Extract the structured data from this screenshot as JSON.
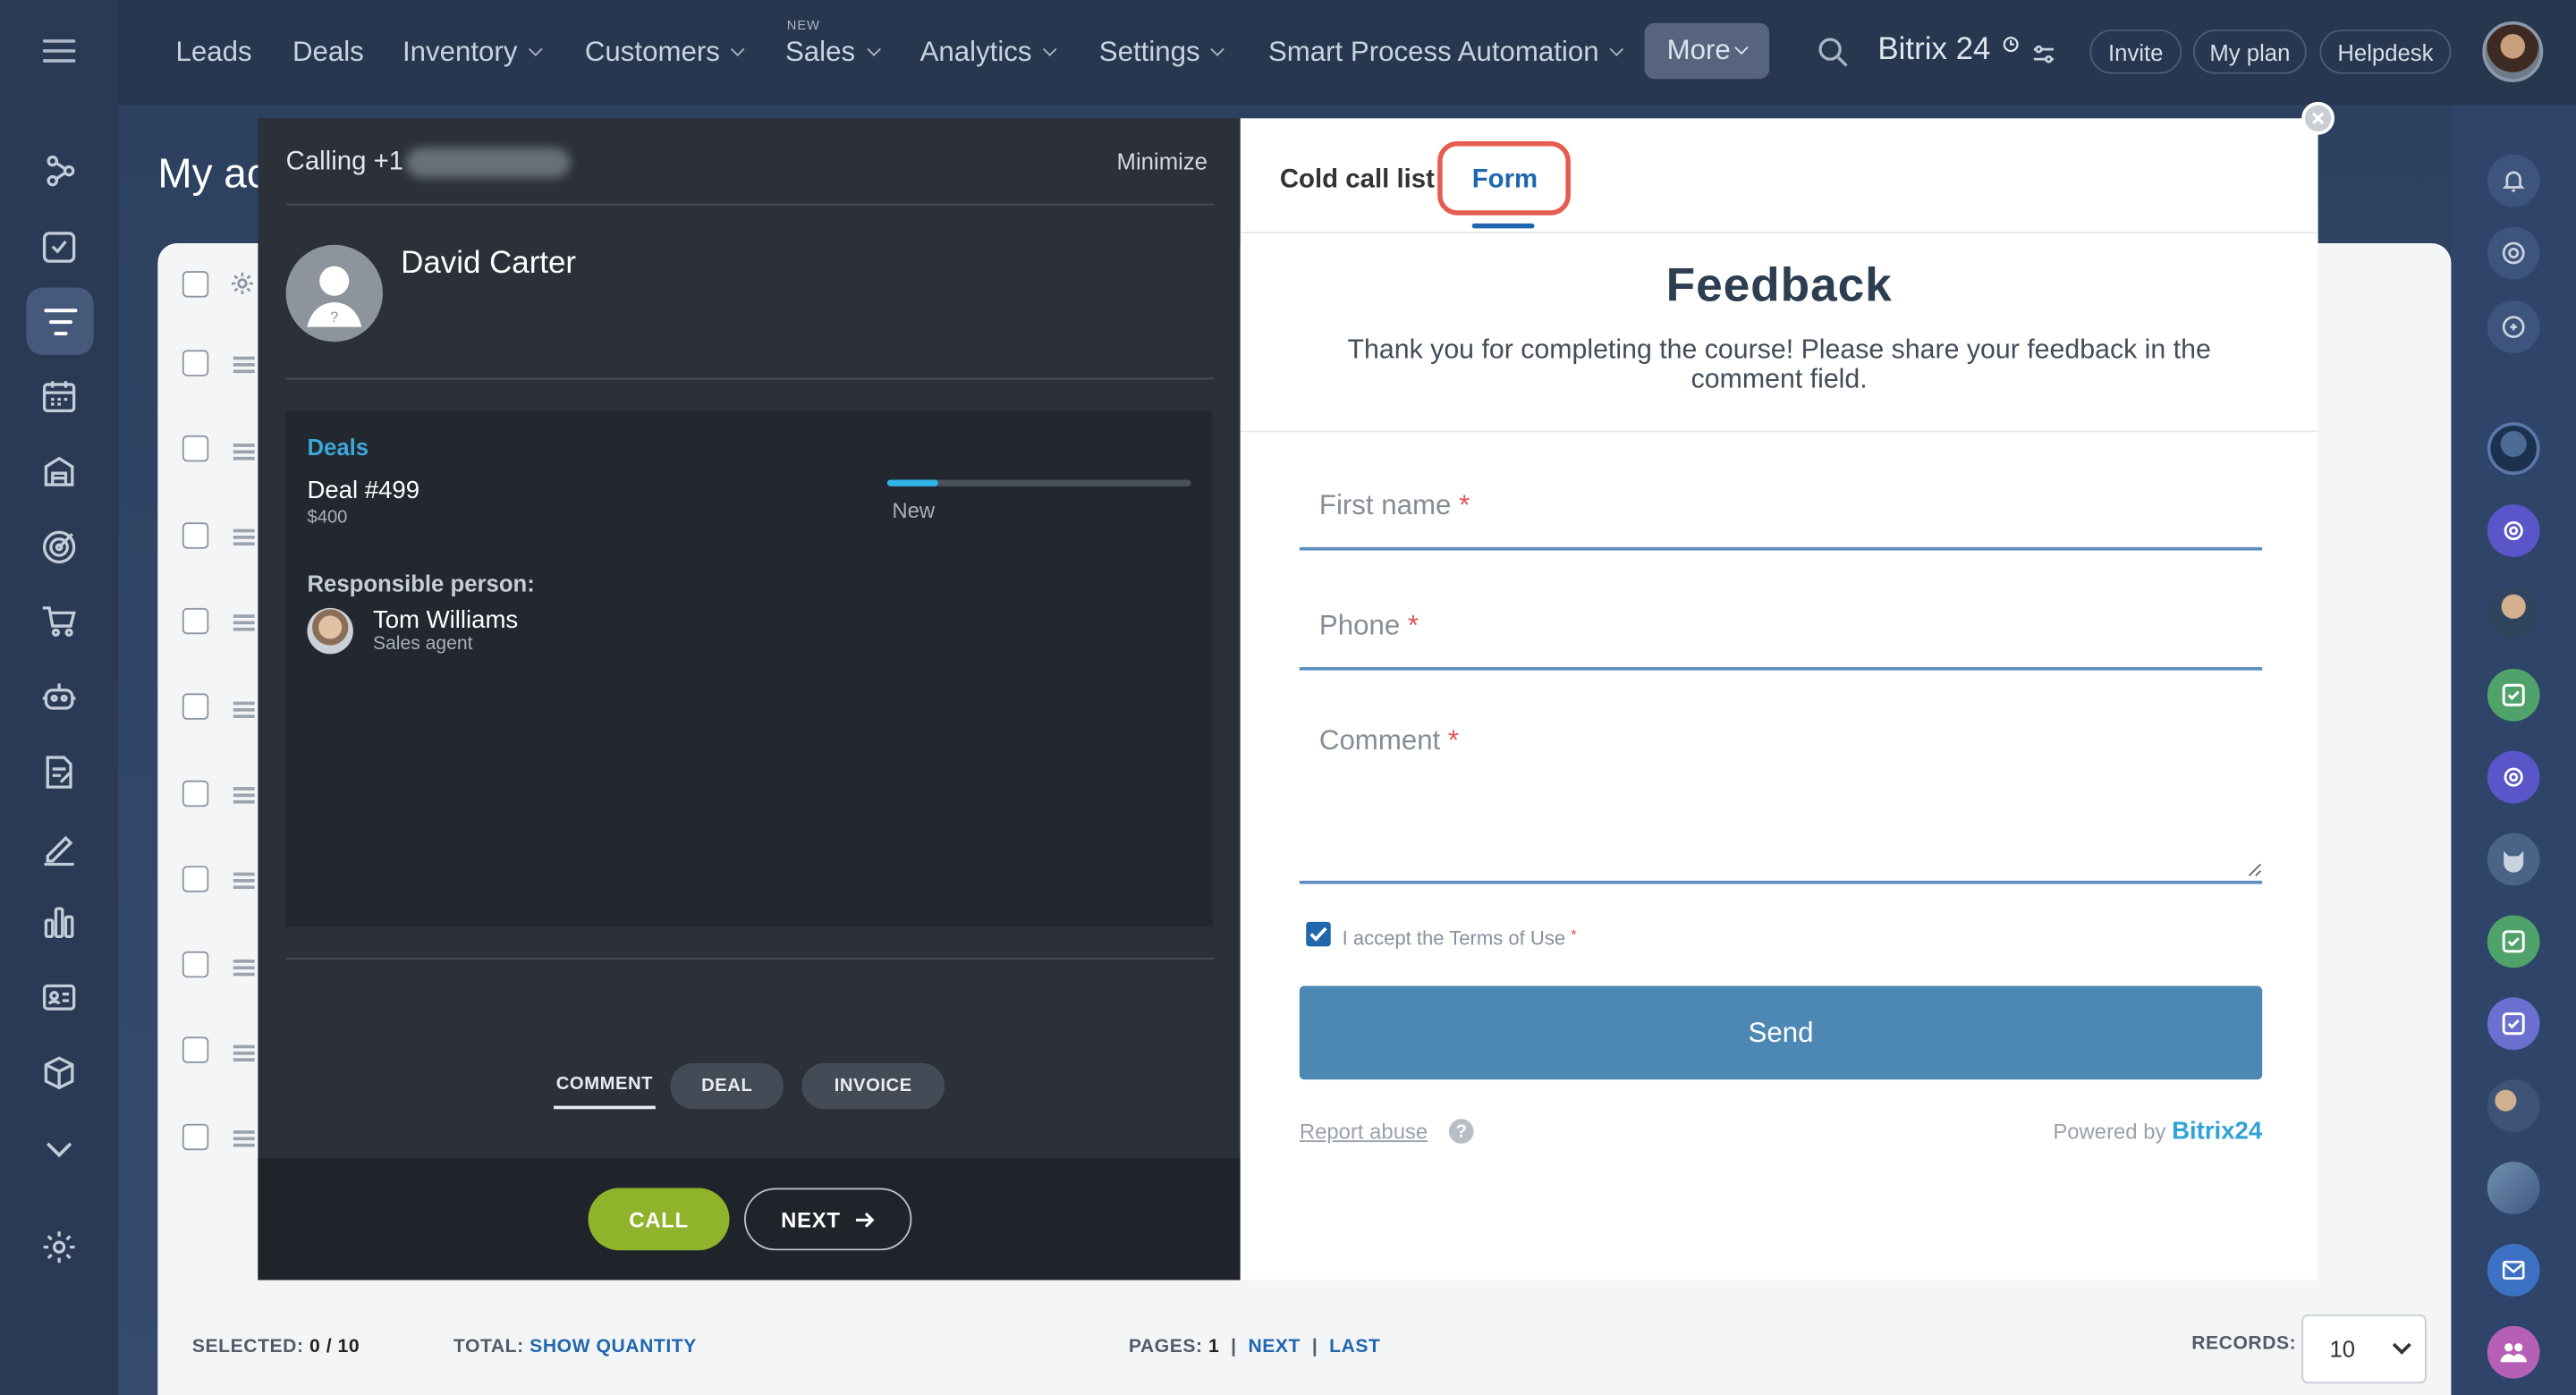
{
  "top_nav": {
    "items": [
      "Leads",
      "Deals",
      "Inventory",
      "Customers",
      "Sales",
      "Analytics",
      "Settings",
      "Smart Process Automation"
    ],
    "new_badge": "NEW",
    "more": "More",
    "brand": "Bitrix 24",
    "invite": "Invite",
    "my_plan": "My plan",
    "helpdesk": "Helpdesk"
  },
  "page": {
    "title": "My ac"
  },
  "list_footer": {
    "selected_label": "SELECTED:",
    "selected_value": "0 / 10",
    "total_label": "TOTAL:",
    "show_quantity": "SHOW QUANTITY",
    "pages_label": "PAGES:",
    "pages_value": "1",
    "next": "NEXT",
    "last": "LAST",
    "records_label": "RECORDS:",
    "records_value": "10"
  },
  "call_panel": {
    "title": "Calling +1",
    "minimize": "Minimize",
    "contact_name": "David Carter",
    "deals_header": "Deals",
    "deal_name": "Deal #499",
    "deal_amount": "$400",
    "deal_stage": "New",
    "deal_progress": 0.17,
    "responsible_header": "Responsible person:",
    "responsible_name": "Tom Williams",
    "responsible_role": "Sales agent",
    "tabs": [
      "COMMENT",
      "DEAL",
      "INVOICE"
    ],
    "call_button": "CALL",
    "next_button": "NEXT"
  },
  "form_panel": {
    "tabs": [
      "Cold call list",
      "Form"
    ],
    "active_tab": "Form",
    "title": "Feedback",
    "description": "Thank you for completing the course! Please share your feedback in the comment field.",
    "fields": [
      {
        "label": "First name",
        "required": "*"
      },
      {
        "label": "Phone",
        "required": "*"
      },
      {
        "label": "Comment",
        "required": "*"
      }
    ],
    "terms_label": "I accept the Terms of Use",
    "terms_required": "*",
    "terms_checked": true,
    "send_button": "Send",
    "report_abuse": "Report abuse",
    "help_glyph": "?",
    "powered_by": "Powered by",
    "powered_brand": "Bitrix24"
  },
  "colors": {
    "accent": "#2067b0",
    "call_green": "#8fb32b",
    "send_blue": "#4d88b4",
    "highlight_red": "#e65c4f"
  }
}
